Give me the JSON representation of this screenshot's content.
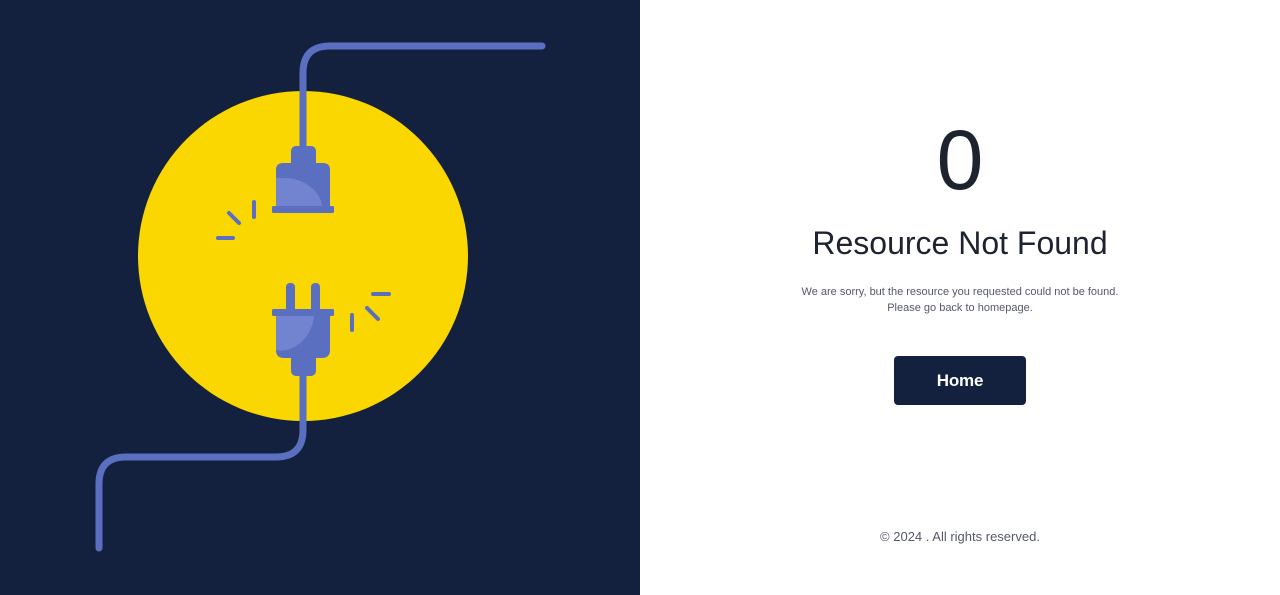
{
  "illustration": {
    "colors": {
      "background": "#13213f",
      "circle": "#fad700",
      "plug": "#5b6fc1",
      "plug_highlight": "#7283cf"
    },
    "icon": "unplugged-cable-icon"
  },
  "error": {
    "code": "0",
    "title": "Resource Not Found",
    "message_line1": "We are sorry, but the resource you requested could not be found.",
    "message_line2": "Please go back to homepage."
  },
  "actions": {
    "home_label": "Home"
  },
  "footer": {
    "copyright": "© 2024 . All rights reserved."
  }
}
